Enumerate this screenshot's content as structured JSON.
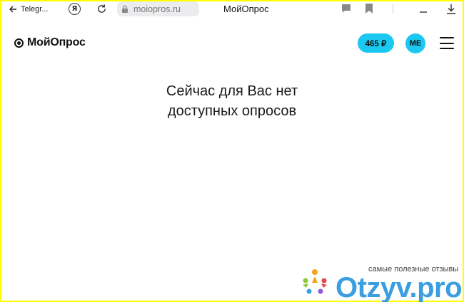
{
  "browser": {
    "back_label": "Telegr...",
    "url": "moiopros.ru",
    "tab_title": "МойОпрос",
    "icons": [
      "arrow-left-icon",
      "yandex-icon",
      "reload-icon",
      "lock-icon",
      "chat-icon",
      "bookmark-icon",
      "minimize-icon",
      "download-icon"
    ]
  },
  "header": {
    "logo_text": "МойОпрос",
    "balance": "465 ₽",
    "avatar_initials": "ME",
    "accent_color": "#1ac8f0"
  },
  "main": {
    "message_line1": "Сейчас для Вас нет",
    "message_line2": "доступных опросов"
  },
  "watermark": {
    "caption": "самые полезные отзывы",
    "brand": "Otzyv.pro"
  }
}
